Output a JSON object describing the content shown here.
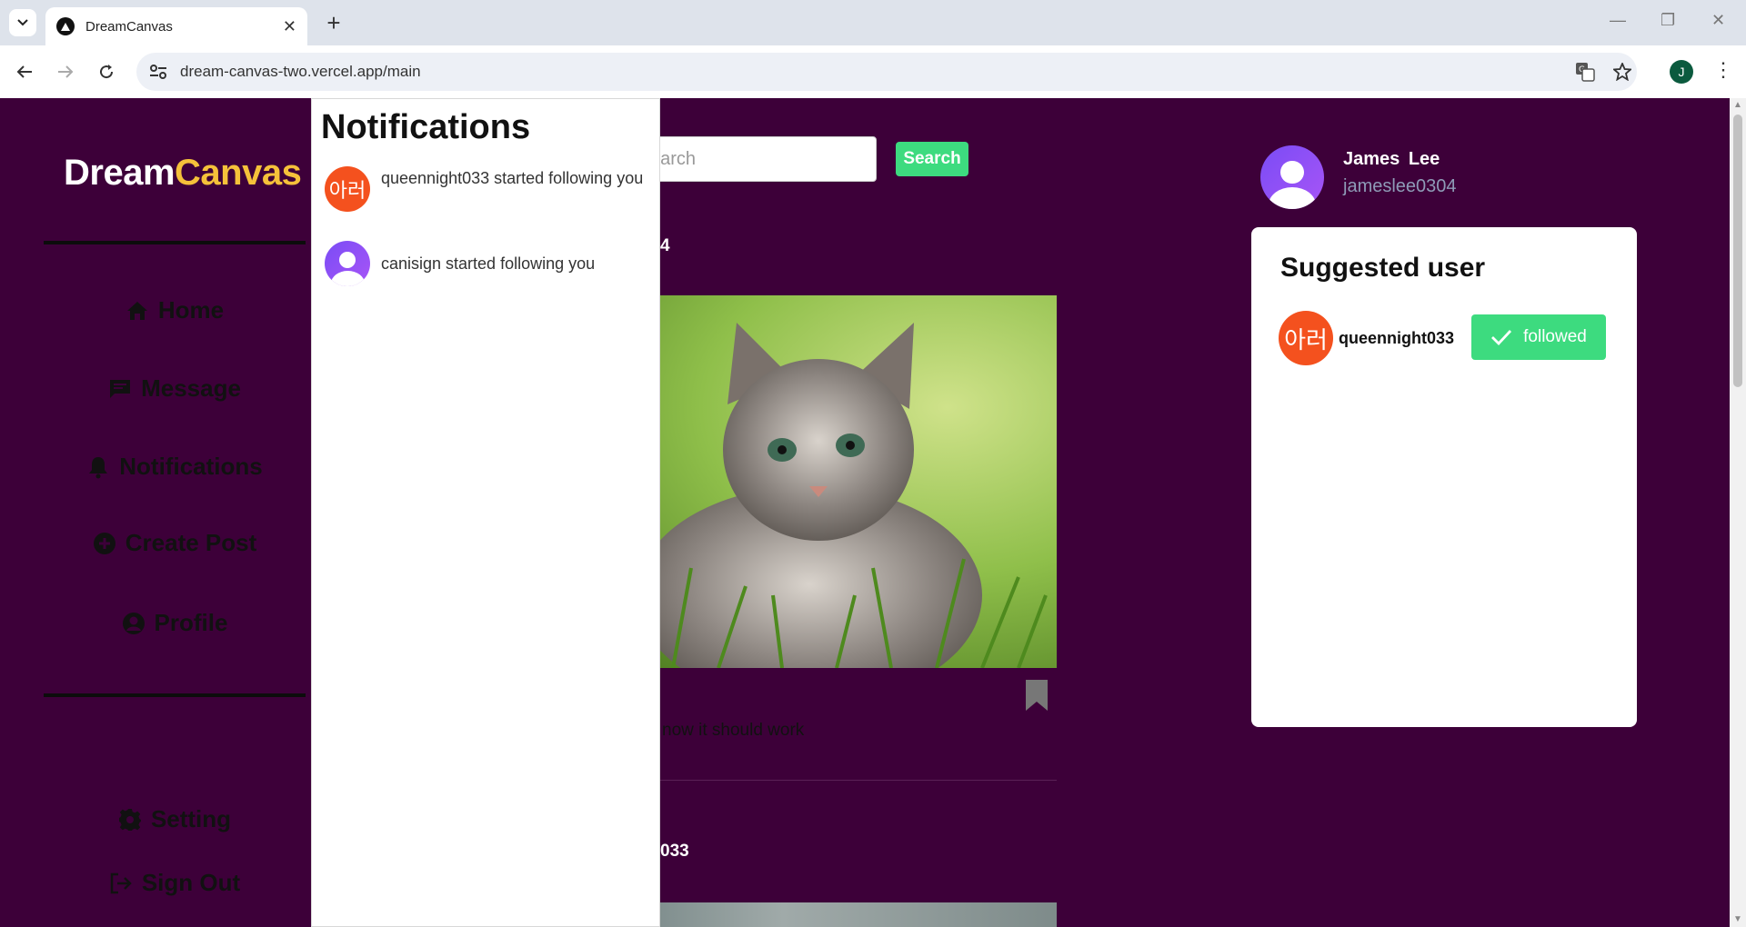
{
  "browser": {
    "tab_title": "DreamCanvas",
    "url": "dream-canvas-two.vercel.app/main",
    "profile_initial": "J"
  },
  "logo": {
    "part1": "Dream",
    "part2": "Canvas"
  },
  "sidebar": {
    "items": [
      {
        "label": "Home",
        "icon": "home-icon"
      },
      {
        "label": "Message",
        "icon": "message-icon"
      },
      {
        "label": "Notifications",
        "icon": "bell-icon"
      },
      {
        "label": "Create Post",
        "icon": "plus-circle-icon"
      },
      {
        "label": "Profile",
        "icon": "user-circle-icon"
      }
    ],
    "bottom": [
      {
        "label": "Setting",
        "icon": "gear-icon"
      },
      {
        "label": "Sign Out",
        "icon": "sign-out-icon"
      }
    ]
  },
  "search": {
    "placeholder": "Search",
    "visible_fragment": "earch",
    "button_label": "Search"
  },
  "feed": {
    "post1_user_fragment": "4",
    "post1_caption_fragment": "now it should work",
    "post2_user_fragment": "033"
  },
  "notifications": {
    "title": "Notifications",
    "items": [
      {
        "avatar_text": "아러",
        "text": "queennight033 started following you"
      },
      {
        "avatar_text": "",
        "text": "canisign started following you"
      }
    ]
  },
  "current_user": {
    "name": "James  Lee",
    "handle": "jameslee0304"
  },
  "suggested": {
    "title": "Suggested user",
    "users": [
      {
        "avatar_text": "아러",
        "username": "queennight033",
        "button_label": "followed"
      }
    ]
  },
  "colors": {
    "background": "#3d0039",
    "accent_yellow": "#f5c13a",
    "button_green": "#3ddb7f",
    "avatar_orange": "#f4511e"
  }
}
